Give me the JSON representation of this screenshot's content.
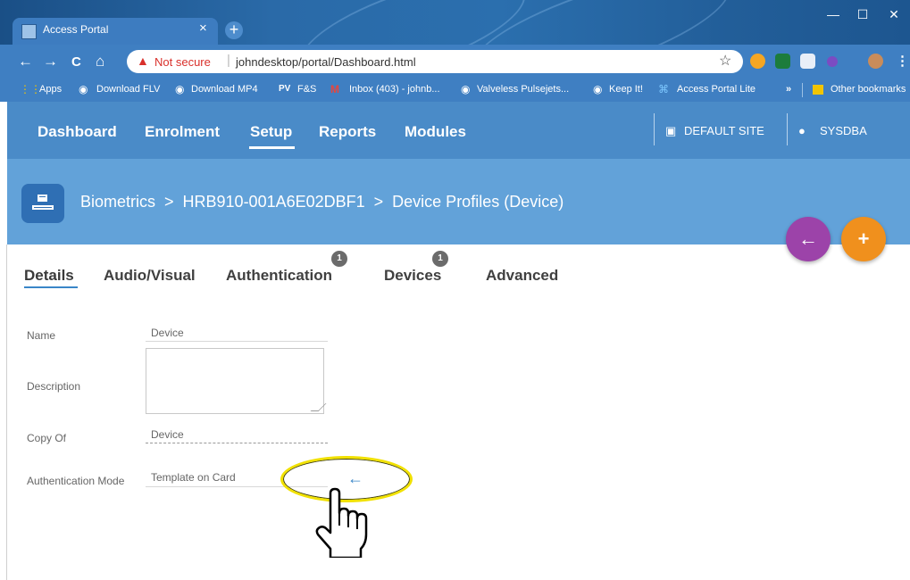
{
  "browser": {
    "tab_title": "Access Portal",
    "tab_close": "×",
    "new_tab": "+",
    "window_controls": {
      "minimize": "—",
      "maximize": "☐",
      "close": "✕"
    },
    "nav": {
      "back": "←",
      "forward": "→",
      "reload": "C",
      "home": "⌂"
    },
    "security_warning": "Not secure",
    "url": "johndesktop/portal/Dashboard.html",
    "bookmarks": [
      "Apps",
      "Download FLV",
      "Download MP4",
      "F&S",
      "Inbox (403) - johnb...",
      "Valveless Pulsejets...",
      "Keep It!",
      "Access Portal Lite",
      "»",
      "Other bookmarks"
    ]
  },
  "nav": {
    "items": [
      "Dashboard",
      "Enrolment",
      "Setup",
      "Reports",
      "Modules"
    ],
    "active": "Setup",
    "site": "DEFAULT SITE",
    "user": "SYSDBA"
  },
  "breadcrumb": "Biometrics  >  HRB910-001A6E02DBF1  >  Device Profiles (Device)",
  "actions": {
    "back": "←",
    "add": "+"
  },
  "tabs": [
    {
      "label": "Details",
      "badge": null
    },
    {
      "label": "Audio/Visual",
      "badge": null
    },
    {
      "label": "Authentication",
      "badge": "1"
    },
    {
      "label": "Devices",
      "badge": "1"
    },
    {
      "label": "Advanced",
      "badge": null
    }
  ],
  "form": {
    "name_label": "Name",
    "name_value": "Device",
    "description_label": "Description",
    "description_value": "",
    "copy_of_label": "Copy Of",
    "copy_of_value": "Device",
    "auth_mode_label": "Authentication Mode",
    "auth_mode_value": "Template on Card",
    "auth_mode_arrow": "←"
  },
  "colors": {
    "nav_bg": "#4a8bc8",
    "banner_bg": "#62a2d9",
    "fab_back": "#9c43a9",
    "fab_add": "#f0901d",
    "highlight": "#f1e100"
  }
}
